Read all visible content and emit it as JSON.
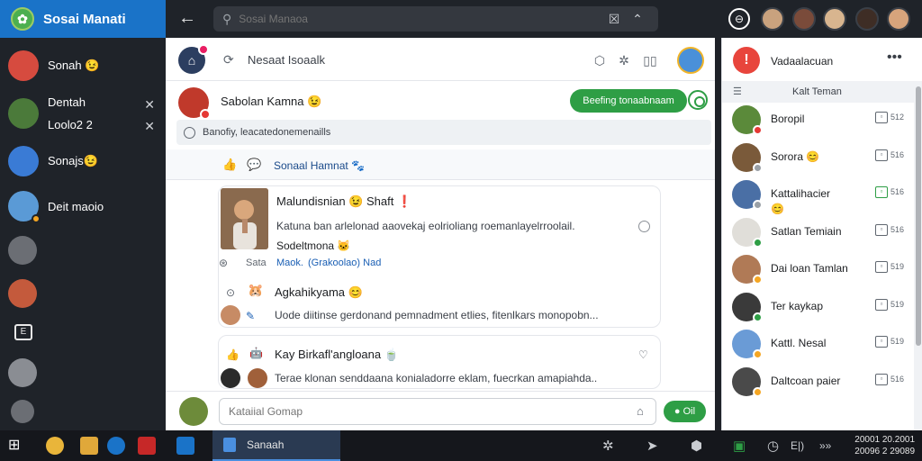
{
  "app": {
    "brand": "Sosai Manati"
  },
  "topbar": {
    "search_placeholder": "Sosai Manaoa"
  },
  "left_sidebar": {
    "items": [
      {
        "label": "Sonah 😉",
        "has_close": false
      },
      {
        "label": "Dentah\nLoolo2 2",
        "has_close": true
      },
      {
        "label": "Sonajs😉",
        "has_close": false
      },
      {
        "label": "Deit maoio",
        "has_close": false
      }
    ]
  },
  "main": {
    "header_title": "Nesaat Isoaalk",
    "post": {
      "author": "Sabolan Kamna 😉",
      "follow_label": "Beefing tonaabnaam",
      "info_text": "Banofiy, leacatedonemenaills",
      "reaction_text": "Sonaal Hamnat 🐾"
    },
    "comments": [
      {
        "title": "Malundisnian 😉 Shaft ❗",
        "text": "Katuna ban arlelonad aaovekaj eolrioliang roemanlayelrroolail.",
        "subtitle": "Sodeltmona 🐱",
        "meta_muted": "Sata",
        "meta_a": "Maok.",
        "meta_link": "(Grakoolao) Nad"
      },
      {
        "title": "Agkahikyama 😊",
        "text": "Uode diitinse gerdonand pemnadment etlies, fitenlkars monopobn..."
      },
      {
        "title": "Kay Birkafl'angloana 🍵",
        "text": "Terae klonan senddaana konialadorre eklam, fuecrkan amapiahda.."
      }
    ],
    "compose_placeholder": "Kataiial Gomap",
    "send_label": "Oil"
  },
  "right_panel": {
    "title": "Vadaalacuan",
    "subheader": "Kalt Teman",
    "friends": [
      {
        "name": "Boropil",
        "count": "512",
        "status": "#e53935",
        "action_color": "#606770"
      },
      {
        "name": "Sorora 😊",
        "count": "516",
        "status": "#9aa0a6",
        "action_color": "#606770"
      },
      {
        "name": "Kattalihacier",
        "subname": "😊",
        "count": "516",
        "status": "#9aa0a6",
        "action_color": "#2e9e45"
      },
      {
        "name": "Satlan Temiain",
        "count": "516",
        "status": "#2e9e45",
        "action_color": "#606770"
      },
      {
        "name": "Dai loan Tamlan",
        "count": "519",
        "status": "#f5a623",
        "action_color": "#606770"
      },
      {
        "name": "Ter kaykap",
        "count": "519",
        "status": "#2e9e45",
        "action_color": "#606770"
      },
      {
        "name": "Kattl. Nesal",
        "count": "519",
        "status": "#f5a623",
        "action_color": "#606770"
      },
      {
        "name": "Daltcoan paier",
        "count": "516",
        "status": "#f5a623",
        "action_color": "#606770"
      }
    ]
  },
  "taskbar": {
    "active_label": "Sanaah",
    "clock_time": "20001  20.2001",
    "clock_date": "20096  2 29089"
  },
  "colors": {
    "accent_blue": "#1a73c8",
    "accent_green": "#2e9e45",
    "dark_bg": "#1f2329"
  },
  "icons": {
    "back": "arrow-left-icon",
    "search": "search-icon",
    "close": "close-icon",
    "more": "more-horizontal-icon"
  }
}
